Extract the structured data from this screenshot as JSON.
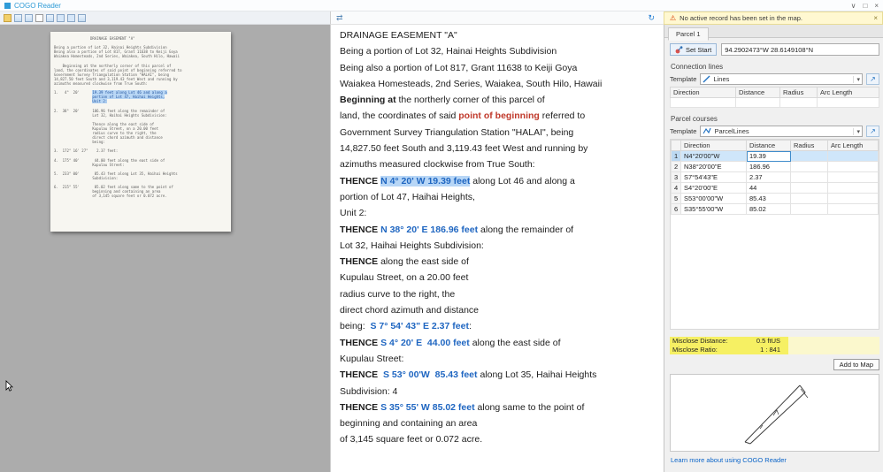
{
  "titlebar": {
    "app_title": "COGO Reader"
  },
  "icons": {
    "chevron": "∨",
    "box": "□",
    "close": "×",
    "warning": "⚠",
    "refresh": "↻",
    "sync": "⇄",
    "caret": "▾",
    "pick": "↗"
  },
  "warning": {
    "text": "No active record has been set in the map."
  },
  "scan": {
    "lines": [
      [
        {
          "t": "                 DRAINAGE EASEMENT \"A\"",
          "s": "n"
        }
      ],
      [
        {
          "t": " ",
          "s": "n"
        }
      ],
      [
        {
          "t": "Being a portion of Lot 32, Hainai Heights Subdivision",
          "s": "n"
        }
      ],
      [
        {
          "t": "Being also a portion of Lot 817, Grant 11638 to Keiji Goya",
          "s": "n"
        }
      ],
      [
        {
          "t": "Waiakea Homesteads, 2nd Series, Waiakea, South Hilo, Hawaii",
          "s": "n"
        }
      ],
      [
        {
          "t": " ",
          "s": "n"
        }
      ],
      [
        {
          "t": "    Beginning at the northerly corner of this parcel of",
          "s": "n"
        }
      ],
      [
        {
          "t": "land, the coordinates of said point of beginning referred to",
          "s": "n"
        }
      ],
      [
        {
          "t": "Government Survey Triangulation Station \"HALAI\", being",
          "s": "n"
        }
      ],
      [
        {
          "t": "14,827.50 feet South and 3,119.43 feet West and running by",
          "s": "n"
        }
      ],
      [
        {
          "t": "azimuths measured clockwise from True South:",
          "s": "n"
        }
      ],
      [
        {
          "t": " ",
          "s": "n"
        }
      ],
      [
        {
          "t": "1.   4°  20'      ",
          "s": "n"
        },
        {
          "t": "19.39 feet along Lot 46 and along a",
          "s": "hl"
        }
      ],
      [
        {
          "t": "                  ",
          "s": "n"
        },
        {
          "t": "portion of Lot 47, Haihai Heights,",
          "s": "hl"
        }
      ],
      [
        {
          "t": "                  ",
          "s": "n"
        },
        {
          "t": "Unit 2:",
          "s": "hl"
        }
      ],
      [
        {
          "t": " ",
          "s": "n"
        }
      ],
      [
        {
          "t": "2.  38°  20'      186.96 feet along the remainder of",
          "s": "n"
        }
      ],
      [
        {
          "t": "                  Lot 32, Haihai Heights Subdivision:",
          "s": "n"
        }
      ],
      [
        {
          "t": " ",
          "s": "n"
        }
      ],
      [
        {
          "t": "                  Thence along the east side of",
          "s": "n"
        }
      ],
      [
        {
          "t": "                  Kupulau Street, on a 20.00 feet",
          "s": "n"
        }
      ],
      [
        {
          "t": "                  radius curve to the right, the",
          "s": "n"
        }
      ],
      [
        {
          "t": "                  direct chord azimuth and distance",
          "s": "n"
        }
      ],
      [
        {
          "t": "                  being:",
          "s": "n"
        }
      ],
      [
        {
          "t": " ",
          "s": "n"
        }
      ],
      [
        {
          "t": "3.  172° 16' 27\"    2.37 feet:",
          "s": "n"
        }
      ],
      [
        {
          "t": " ",
          "s": "n"
        }
      ],
      [
        {
          "t": "4.  175° 40'       44.00 feet along the east side of",
          "s": "n"
        }
      ],
      [
        {
          "t": "                  Kupulau Street:",
          "s": "n"
        }
      ],
      [
        {
          "t": " ",
          "s": "n"
        }
      ],
      [
        {
          "t": "5.  233° 00'       85.43 feet along Lot 35, Haihai Heights",
          "s": "n"
        }
      ],
      [
        {
          "t": "                  Subdivision:",
          "s": "n"
        }
      ],
      [
        {
          "t": " ",
          "s": "n"
        }
      ],
      [
        {
          "t": "6.  215° 55'       85.02 feet along same to the point of",
          "s": "n"
        }
      ],
      [
        {
          "t": "                  beginning and containing an area",
          "s": "n"
        }
      ],
      [
        {
          "t": "                  of 3,145 square feet or 0.072 acre.",
          "s": "n"
        }
      ]
    ]
  },
  "transcript": {
    "lines": [
      [
        {
          "t": "DRAINAGE EASEMENT \"A\"",
          "s": "n"
        }
      ],
      [
        {
          "t": "Being a portion of Lot 32, Hainai Heights Subdivision",
          "s": "n"
        }
      ],
      [
        {
          "t": "Being also a portion of Lot 817, Grant 11638 to Keiji Goya",
          "s": "n"
        }
      ],
      [
        {
          "t": "Waiakea Homesteads, 2nd Series, Waiakea, South Hilo, Hawaii",
          "s": "n"
        }
      ],
      [
        {
          "t": "Beginning at",
          "s": "b"
        },
        {
          "t": " the northerly corner of this parcel of",
          "s": "n"
        }
      ],
      [
        {
          "t": "land, the coordinates of said ",
          "s": "n"
        },
        {
          "t": "point of beginning",
          "s": "rb"
        },
        {
          "t": " referred to",
          "s": "n"
        }
      ],
      [
        {
          "t": "Government Survey Triangulation Station \"HALAI\", being",
          "s": "n"
        }
      ],
      [
        {
          "t": "14,827.50 feet South and 3,119.43 feet West and running by",
          "s": "n"
        }
      ],
      [
        {
          "t": "azimuths measured clockwise from True South:",
          "s": "n"
        }
      ],
      [
        {
          "t": "THENCE ",
          "s": "b"
        },
        {
          "t": "N 4° 20' W 19.39 feet",
          "s": "sel"
        },
        {
          "t": " along Lot 46 and along a",
          "s": "n"
        }
      ],
      [
        {
          "t": "portion of Lot 47, Haihai Heights,",
          "s": "n"
        }
      ],
      [
        {
          "t": "Unit 2:",
          "s": "n"
        }
      ],
      [
        {
          "t": "THENCE ",
          "s": "b"
        },
        {
          "t": "N 38° 20' E 186.96 feet",
          "s": "bb"
        },
        {
          "t": " along the remainder of",
          "s": "n"
        }
      ],
      [
        {
          "t": "Lot 32, Haihai Heights Subdivision:",
          "s": "n"
        }
      ],
      [
        {
          "t": "THENCE",
          "s": "b"
        },
        {
          "t": " along the east side of",
          "s": "n"
        }
      ],
      [
        {
          "t": "Kupulau Street, on a 20.00 feet",
          "s": "n"
        }
      ],
      [
        {
          "t": "radius curve to the right, the",
          "s": "n"
        }
      ],
      [
        {
          "t": "direct chord azimuth and distance",
          "s": "n"
        }
      ],
      [
        {
          "t": "being:  ",
          "s": "n"
        },
        {
          "t": "S 7° 54' 43\" E 2.37 feet",
          "s": "bb"
        },
        {
          "t": ":",
          "s": "n"
        }
      ],
      [
        {
          "t": "THENCE ",
          "s": "b"
        },
        {
          "t": "S 4° 20' E  44.00 feet",
          "s": "bb"
        },
        {
          "t": " along the east side of",
          "s": "n"
        }
      ],
      [
        {
          "t": "Kupulau Street:",
          "s": "n"
        }
      ],
      [
        {
          "t": "THENCE  ",
          "s": "b"
        },
        {
          "t": "S 53° 00'W  85.43 feet",
          "s": "bb"
        },
        {
          "t": " along Lot 35, Haihai Heights",
          "s": "n"
        }
      ],
      [
        {
          "t": "Subdivision: 4",
          "s": "n"
        }
      ],
      [
        {
          "t": "THENCE ",
          "s": "b"
        },
        {
          "t": "S 35° 55' W 85.02 feet",
          "s": "bb"
        },
        {
          "t": " along same to the point of",
          "s": "n"
        }
      ],
      [
        {
          "t": "beginning and containing an area",
          "s": "n"
        }
      ],
      [
        {
          "t": "of 3,145 square feet or 0.072 acre.",
          "s": "n"
        }
      ]
    ]
  },
  "parcel": {
    "tab": "Parcel 1",
    "set_start_label": "Set Start",
    "start_coords": "94.2902473°W 28.6149108°N",
    "connection": {
      "group": "Connection lines",
      "template_label": "Template",
      "template_value": "Lines",
      "headers": [
        "Direction",
        "Distance",
        "Radius",
        "Arc Length"
      ],
      "rows": [
        {
          "n": "",
          "sel": false,
          "cells": [
            "",
            "",
            "",
            ""
          ]
        }
      ]
    },
    "courses": {
      "group": "Parcel courses",
      "template_label": "Template",
      "template_value": "ParcelLines",
      "headers": [
        "Direction",
        "Distance",
        "Radius",
        "Arc Length"
      ],
      "rows": [
        {
          "n": "1",
          "sel": true,
          "cells": [
            "N4°20'00\"W",
            "19.39",
            "",
            ""
          ]
        },
        {
          "n": "2",
          "sel": false,
          "cells": [
            "N38°20'00\"E",
            "186.96",
            "",
            ""
          ]
        },
        {
          "n": "3",
          "sel": false,
          "cells": [
            "S7°54'43\"E",
            "2.37",
            "",
            ""
          ]
        },
        {
          "n": "4",
          "sel": false,
          "cells": [
            "S4°20'00\"E",
            "44",
            "",
            ""
          ]
        },
        {
          "n": "5",
          "sel": false,
          "cells": [
            "S53°00'00\"W",
            "85.43",
            "",
            ""
          ]
        },
        {
          "n": "6",
          "sel": false,
          "cells": [
            "S35°55'00\"W",
            "85.02",
            "",
            ""
          ]
        }
      ]
    },
    "misclose": {
      "distance_label": "Misclose Distance:",
      "distance_value": "0.5 ftUS",
      "ratio_label": "Misclose Ratio:",
      "ratio_value": "1 : 841"
    },
    "add_to_map": "Add to Map",
    "learn_more": "Learn more about using COGO Reader"
  }
}
